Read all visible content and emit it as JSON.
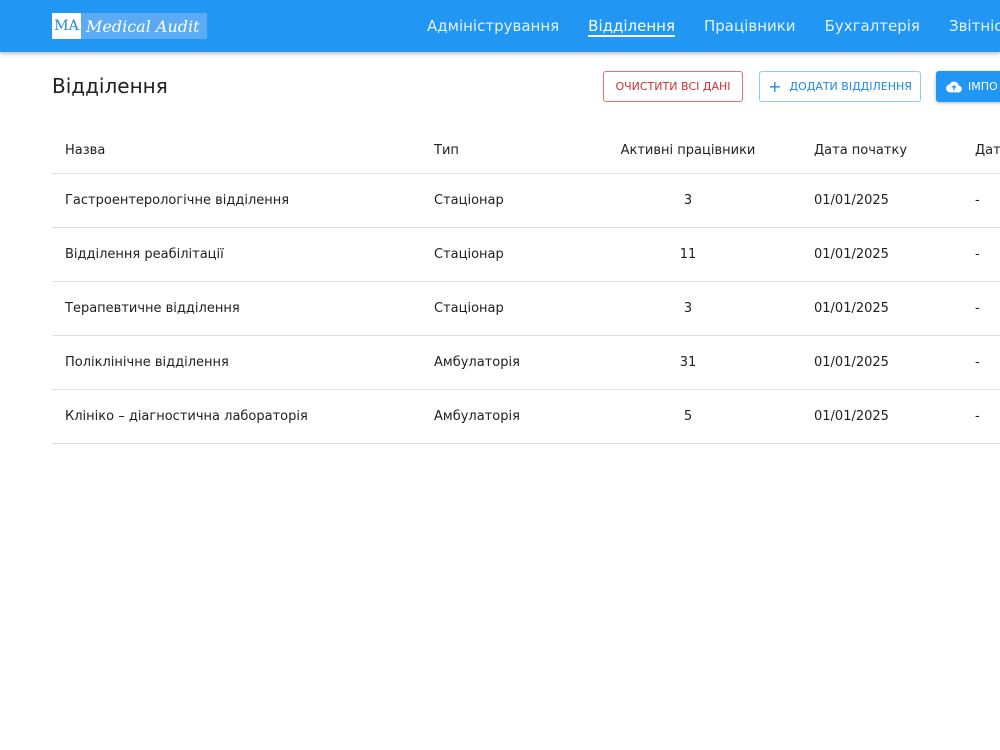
{
  "app": {
    "logo_badge": "MA",
    "logo_text": "Medical Audit"
  },
  "nav": {
    "items": [
      {
        "label": "Адміністрування",
        "active": false
      },
      {
        "label": "Відділення",
        "active": true
      },
      {
        "label": "Працівники",
        "active": false
      },
      {
        "label": "Бухгалтерія",
        "active": false
      },
      {
        "label": "Звітність",
        "active": false
      }
    ]
  },
  "page": {
    "title": "Відділення"
  },
  "actions": {
    "clear_label": "ОЧИСТИТИ ВСІ ДАНІ",
    "add_plus": "+",
    "add_label": "ДОДАТИ ВІДДІЛЕННЯ",
    "import_label": "ІМПО"
  },
  "table": {
    "columns": [
      "Назва",
      "Тип",
      "Активні працівники",
      "Дата початку",
      "Дата"
    ],
    "rows": [
      [
        "Гастроентерологічне відділення",
        "Стаціонар",
        "3",
        "01/01/2025",
        "-"
      ],
      [
        "Відділення реабілітації",
        "Стаціонар",
        "11",
        "01/01/2025",
        "-"
      ],
      [
        "Терапевтичне відділення",
        "Стаціонар",
        "3",
        "01/01/2025",
        "-"
      ],
      [
        "Поліклінічне відділення",
        "Амбулаторія",
        "31",
        "01/01/2025",
        "-"
      ],
      [
        "Клініко – діагностична лабораторія",
        "Амбулаторія",
        "5",
        "01/01/2025",
        "-"
      ]
    ]
  },
  "colors": {
    "primary": "#2196f3",
    "danger": "#d32f2f"
  }
}
